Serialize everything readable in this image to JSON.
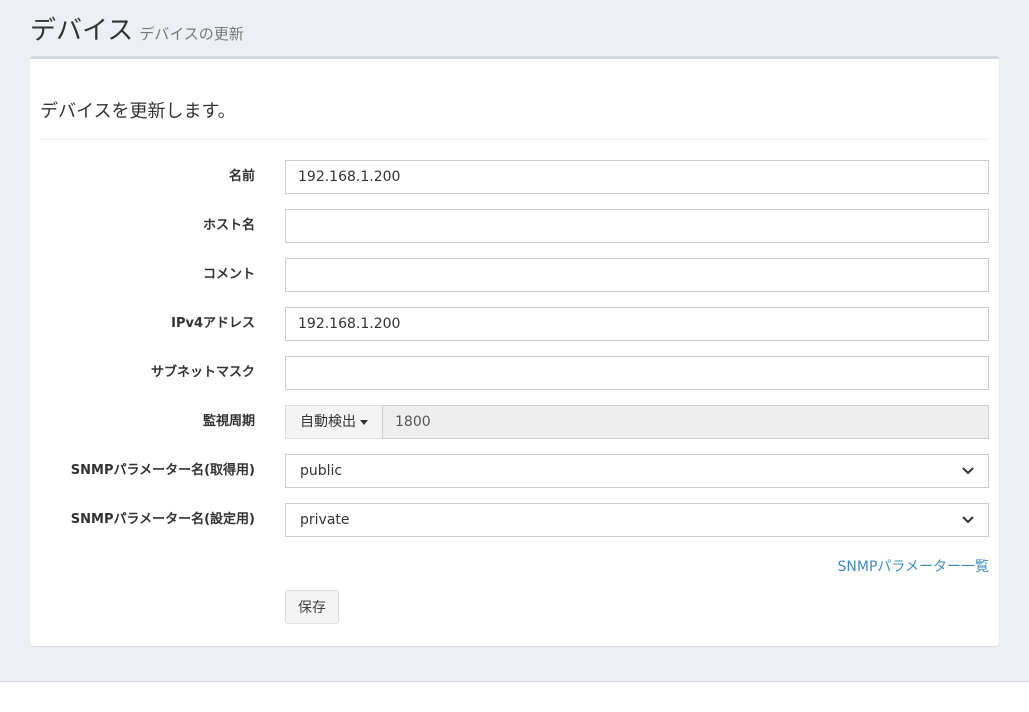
{
  "header": {
    "title": "デバイス",
    "subtitle": "デバイスの更新"
  },
  "form": {
    "intro": "デバイスを更新します。",
    "fields": {
      "name": {
        "label": "名前",
        "value": "192.168.1.200"
      },
      "hostname": {
        "label": "ホスト名",
        "value": ""
      },
      "comment": {
        "label": "コメント",
        "value": ""
      },
      "ipv4": {
        "label": "IPv4アドレス",
        "value": "192.168.1.200"
      },
      "subnet": {
        "label": "サブネットマスク",
        "value": ""
      },
      "interval": {
        "label": "監視周期",
        "mode": "自動検出",
        "value": "1800"
      },
      "snmp_get": {
        "label": "SNMPパラメーター名(取得用)",
        "value": "public"
      },
      "snmp_set": {
        "label": "SNMPパラメーター名(設定用)",
        "value": "private"
      }
    },
    "snmp_list_link": "SNMPパラメーター一覧",
    "save_label": "保存"
  },
  "icons": {
    "caret": "caret-down-icon",
    "chevron": "chevron-down-icon"
  },
  "colors": {
    "background": "#ecf0f5",
    "link": "#3c8dbc",
    "box_border": "#d2d6de"
  }
}
